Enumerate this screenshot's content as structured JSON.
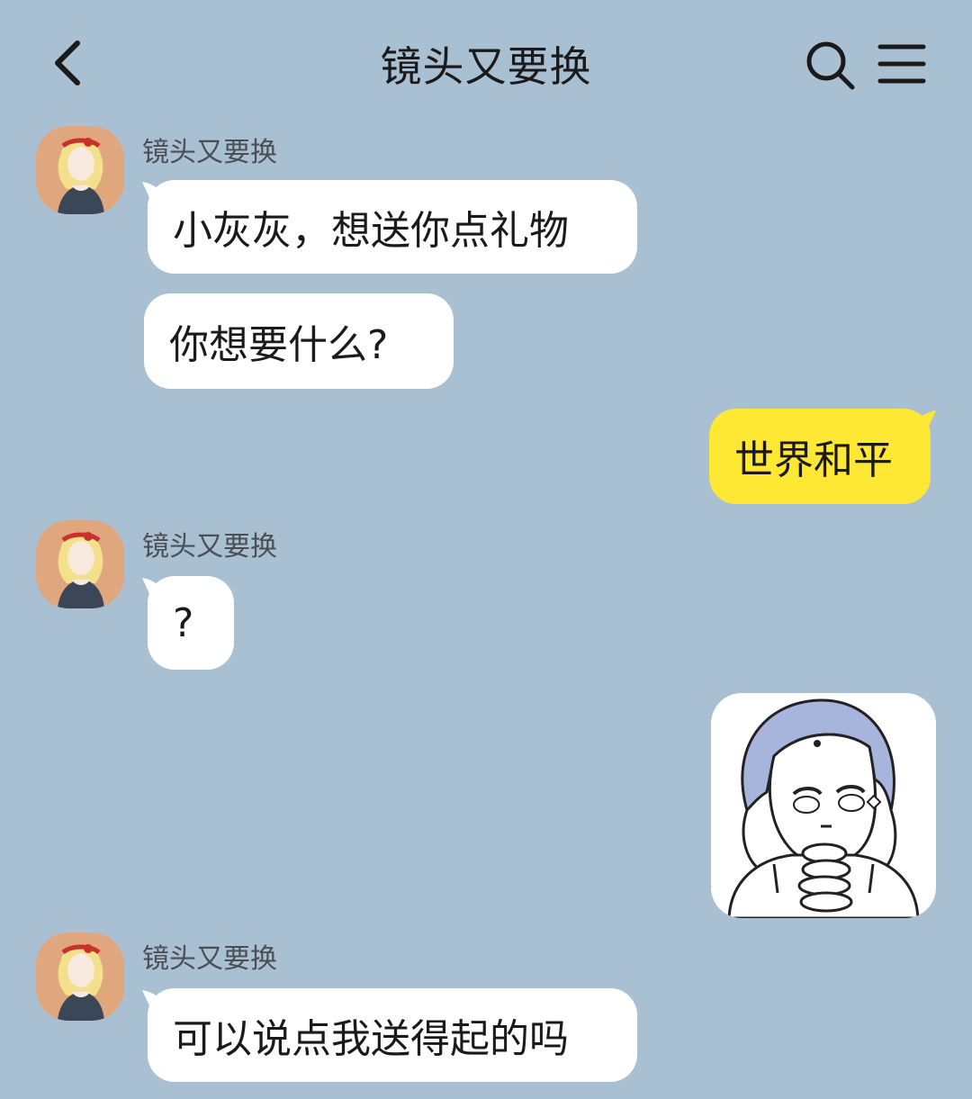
{
  "header": {
    "title": "镜头又要换"
  },
  "messages": [
    {
      "sender": "镜头又要换",
      "text": "小灰灰，想送你点礼物"
    },
    {
      "text": "你想要什么?"
    },
    {
      "self": true,
      "text": "世界和平"
    },
    {
      "sender": "镜头又要换",
      "text": "?"
    },
    {
      "self": true,
      "sticker": "anime-girl-clasped-hands-sticker"
    },
    {
      "sender": "镜头又要换",
      "text": "可以说点我送得起的吗"
    }
  ],
  "colors": {
    "background": "#a9bfd2",
    "incoming_bubble": "#ffffff",
    "outgoing_bubble": "#fee833"
  },
  "icons": {
    "back": "chevron-left-icon",
    "search": "search-icon",
    "menu": "hamburger-menu-icon"
  }
}
